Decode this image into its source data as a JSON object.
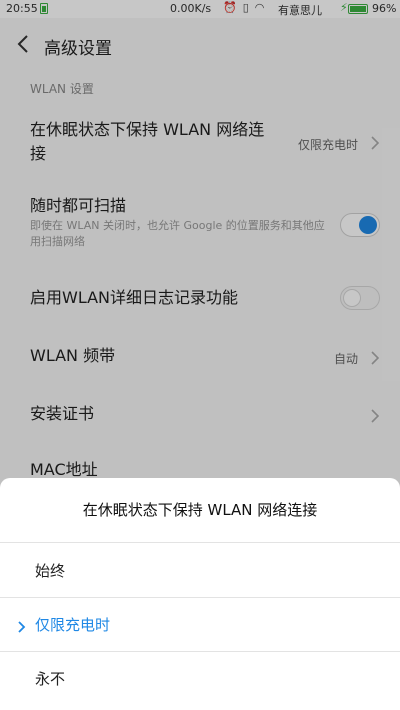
{
  "status": {
    "time": "20:55",
    "speed": "0.00K/s",
    "carrier": "有意思儿",
    "battery": "96%"
  },
  "header": {
    "title": "高级设置"
  },
  "sections": {
    "wlan_settings": "WLAN 设置"
  },
  "rows": [
    {
      "title": "在休眠状态下保持 WLAN 网络连接",
      "value": "仅限充电时"
    },
    {
      "title": "随时都可扫描",
      "sub": "即使在 WLAN 关闭时，也允许 Google 的位置服务和其他应用扫描网络",
      "toggle": true
    },
    {
      "title": "启用WLAN详细日志记录功能",
      "toggle": false
    },
    {
      "title": "WLAN 频带",
      "value": "自动"
    },
    {
      "title": "安装证书"
    },
    {
      "title": "MAC地址"
    }
  ],
  "dialog": {
    "title": "在休眠状态下保持  WLAN  网络连接",
    "options": [
      {
        "label": "始终",
        "selected": false
      },
      {
        "label": "仅限充电时",
        "selected": true
      },
      {
        "label": "永不",
        "selected": false
      }
    ]
  },
  "colors": {
    "accent": "#1f88e5",
    "battery": "#3cb043"
  }
}
